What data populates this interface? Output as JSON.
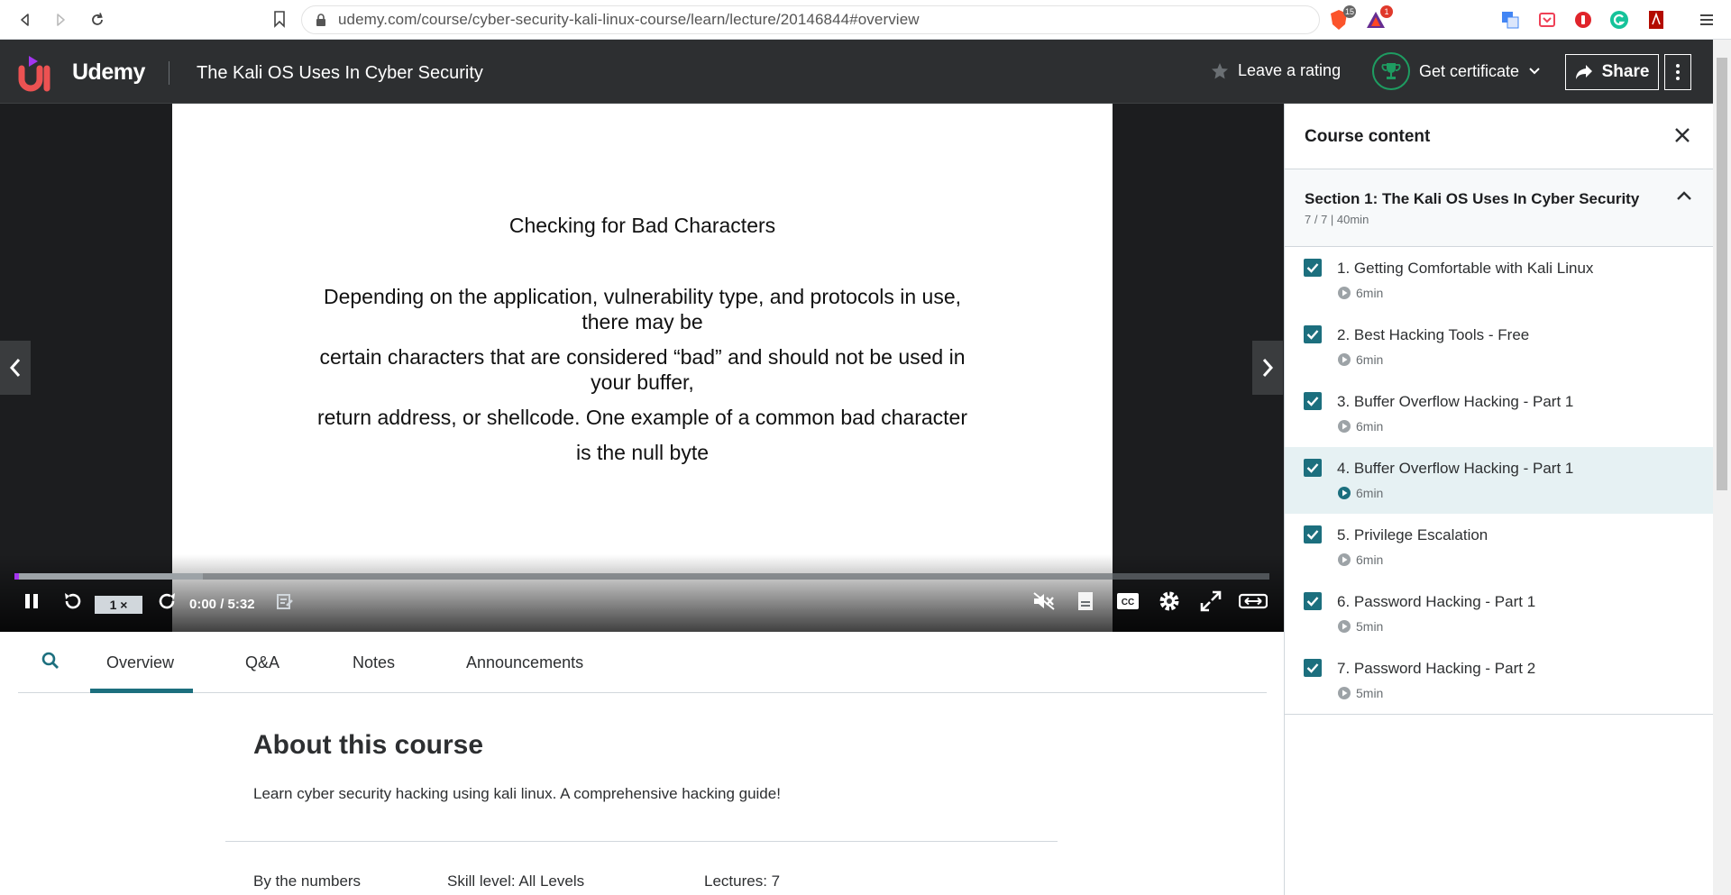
{
  "browser": {
    "url": "udemy.com/course/cyber-security-kali-linux-course/learn/lecture/20146844#overview",
    "brave_badge": "15",
    "bat_badge": "1"
  },
  "header": {
    "logo_text": "Udemy",
    "course_title": "The Kali OS Uses In Cyber Security",
    "rating_label": "Leave a rating",
    "certificate_label": "Get certificate",
    "share_label": "Share"
  },
  "video": {
    "slide_title": "Checking for Bad Characters",
    "slide_lines": [
      "Depending on the application, vulnerability type, and protocols in use,",
      "there may be",
      "certain characters that are considered “bad” and should not be used in",
      "your buffer,",
      "return address, or shellcode. One example of a common bad character",
      "is the null byte"
    ],
    "speed": "1 ×",
    "time": "0:00 / 5:32",
    "progress_fraction": 0.0,
    "buffered_fraction": 0.15
  },
  "tabs": {
    "items": [
      "Overview",
      "Q&A",
      "Notes",
      "Announcements"
    ],
    "active": "Overview"
  },
  "about": {
    "title": "About this course",
    "description": "Learn cyber security hacking using kali linux. A comprehensive hacking guide!",
    "by_numbers": "By the numbers",
    "skill_level": "Skill level: All Levels",
    "lectures": "Lectures: 7"
  },
  "sidebar": {
    "title": "Course content",
    "section_title": "Section 1: The Kali OS Uses In Cyber Security",
    "section_meta": "7 / 7 | 40min",
    "lectures": [
      {
        "title": "1. Getting Comfortable with Kali Linux",
        "duration": "6min",
        "completed": true
      },
      {
        "title": "2. Best Hacking Tools - Free",
        "duration": "6min",
        "completed": true
      },
      {
        "title": "3. Buffer Overflow Hacking - Part 1",
        "duration": "6min",
        "completed": true
      },
      {
        "title": "4. Buffer Overflow Hacking - Part 1",
        "duration": "6min",
        "completed": true,
        "active": true
      },
      {
        "title": "5. Privilege  Escalation",
        "duration": "6min",
        "completed": true
      },
      {
        "title": "6. Password Hacking - Part 1",
        "duration": "5min",
        "completed": true
      },
      {
        "title": "7. Password Hacking - Part 2",
        "duration": "5min",
        "completed": true
      }
    ]
  },
  "colors": {
    "header_bg": "#2d2f31",
    "accent_teal": "#1c6f7e",
    "certificate_green": "#1e9c61"
  }
}
